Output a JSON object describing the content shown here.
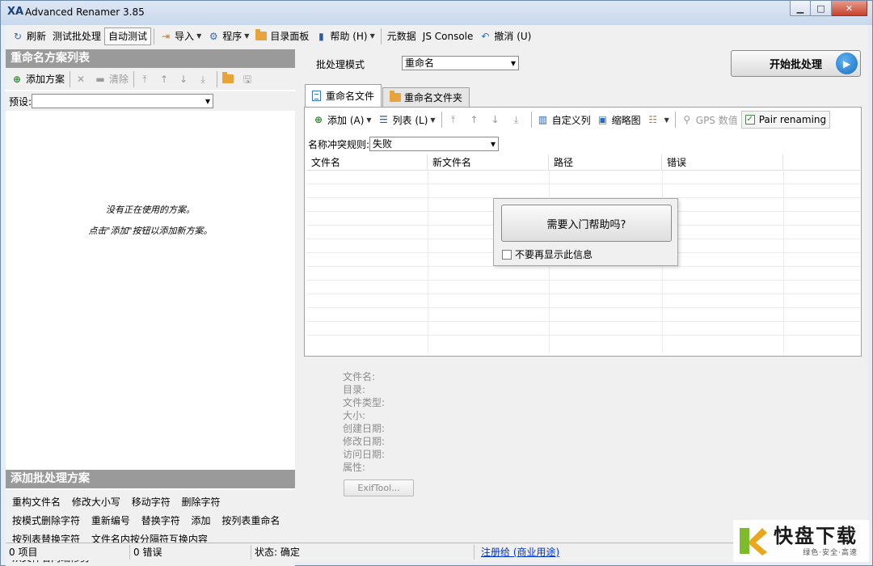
{
  "window": {
    "title": "Advanced Renamer 3.85",
    "app_icon_text": "XA"
  },
  "toolbar": {
    "refresh": "刷新",
    "test_batch": "测试批处理",
    "auto_test": "自动测试",
    "import": "导入",
    "program": "程序",
    "dir_panel": "目录面板",
    "help": "帮助 (H)",
    "metadata": "元数据",
    "js_console": "JS Console",
    "undo": "撤消 (U)"
  },
  "left": {
    "methods_header": "重命名方案列表",
    "add_method": "添加方案",
    "clear": "清除",
    "preset_label": "预设:",
    "preset_value": "",
    "empty_line1": "没有正在使用的方案。",
    "empty_line2": "点击\"添加\"按钮以添加新方案。",
    "batch_header": "添加批处理方案",
    "batch_methods": [
      "重构文件名",
      "修改大小写",
      "移动字符",
      "删除字符",
      "按模式删除字符",
      "重新编号",
      "替换字符",
      "添加",
      "按列表重命名",
      "按列表替换字符",
      "文件名内按分隔符互换内容",
      "从文件名两端修剪"
    ]
  },
  "right": {
    "mode_label": "批处理模式",
    "mode_value": "重命名",
    "start_button": "开始批处理",
    "tabs": [
      "重命名文件",
      "重命名文件夹"
    ],
    "add": "添加 (A)",
    "list": "列表 (L)",
    "custom_columns": "自定义列",
    "thumbnails": "缩略图",
    "gps": "GPS 数值",
    "pair_renaming": "Pair renaming",
    "conflict_label": "名称冲突规则:",
    "conflict_value": "失败",
    "columns": [
      "文件名",
      "新文件名",
      "路径",
      "错误"
    ],
    "help_popup": {
      "question": "需要入门帮助吗?",
      "dont_show": "不要再显示此信息"
    },
    "info_labels": [
      "文件名:",
      "目录:",
      "文件类型:",
      "大小:",
      "创建日期:",
      "修改日期:",
      "访问日期:",
      "属性:"
    ],
    "exiftool": "ExifTool..."
  },
  "status": {
    "items": "0 项目",
    "errors": "0 错误",
    "state": "状态: 确定",
    "registered": "注册给 (商业用途)"
  },
  "watermark": {
    "logo_char": "K",
    "brand": "快盘下载",
    "tagline": "绿色·安全·高速"
  },
  "colors": {
    "section_header": "#9a9a9a",
    "start_icon": "#1a6fc2",
    "link": "#0033cc",
    "add_icon": "#2c8a2c",
    "folder": "#e8a43a"
  }
}
